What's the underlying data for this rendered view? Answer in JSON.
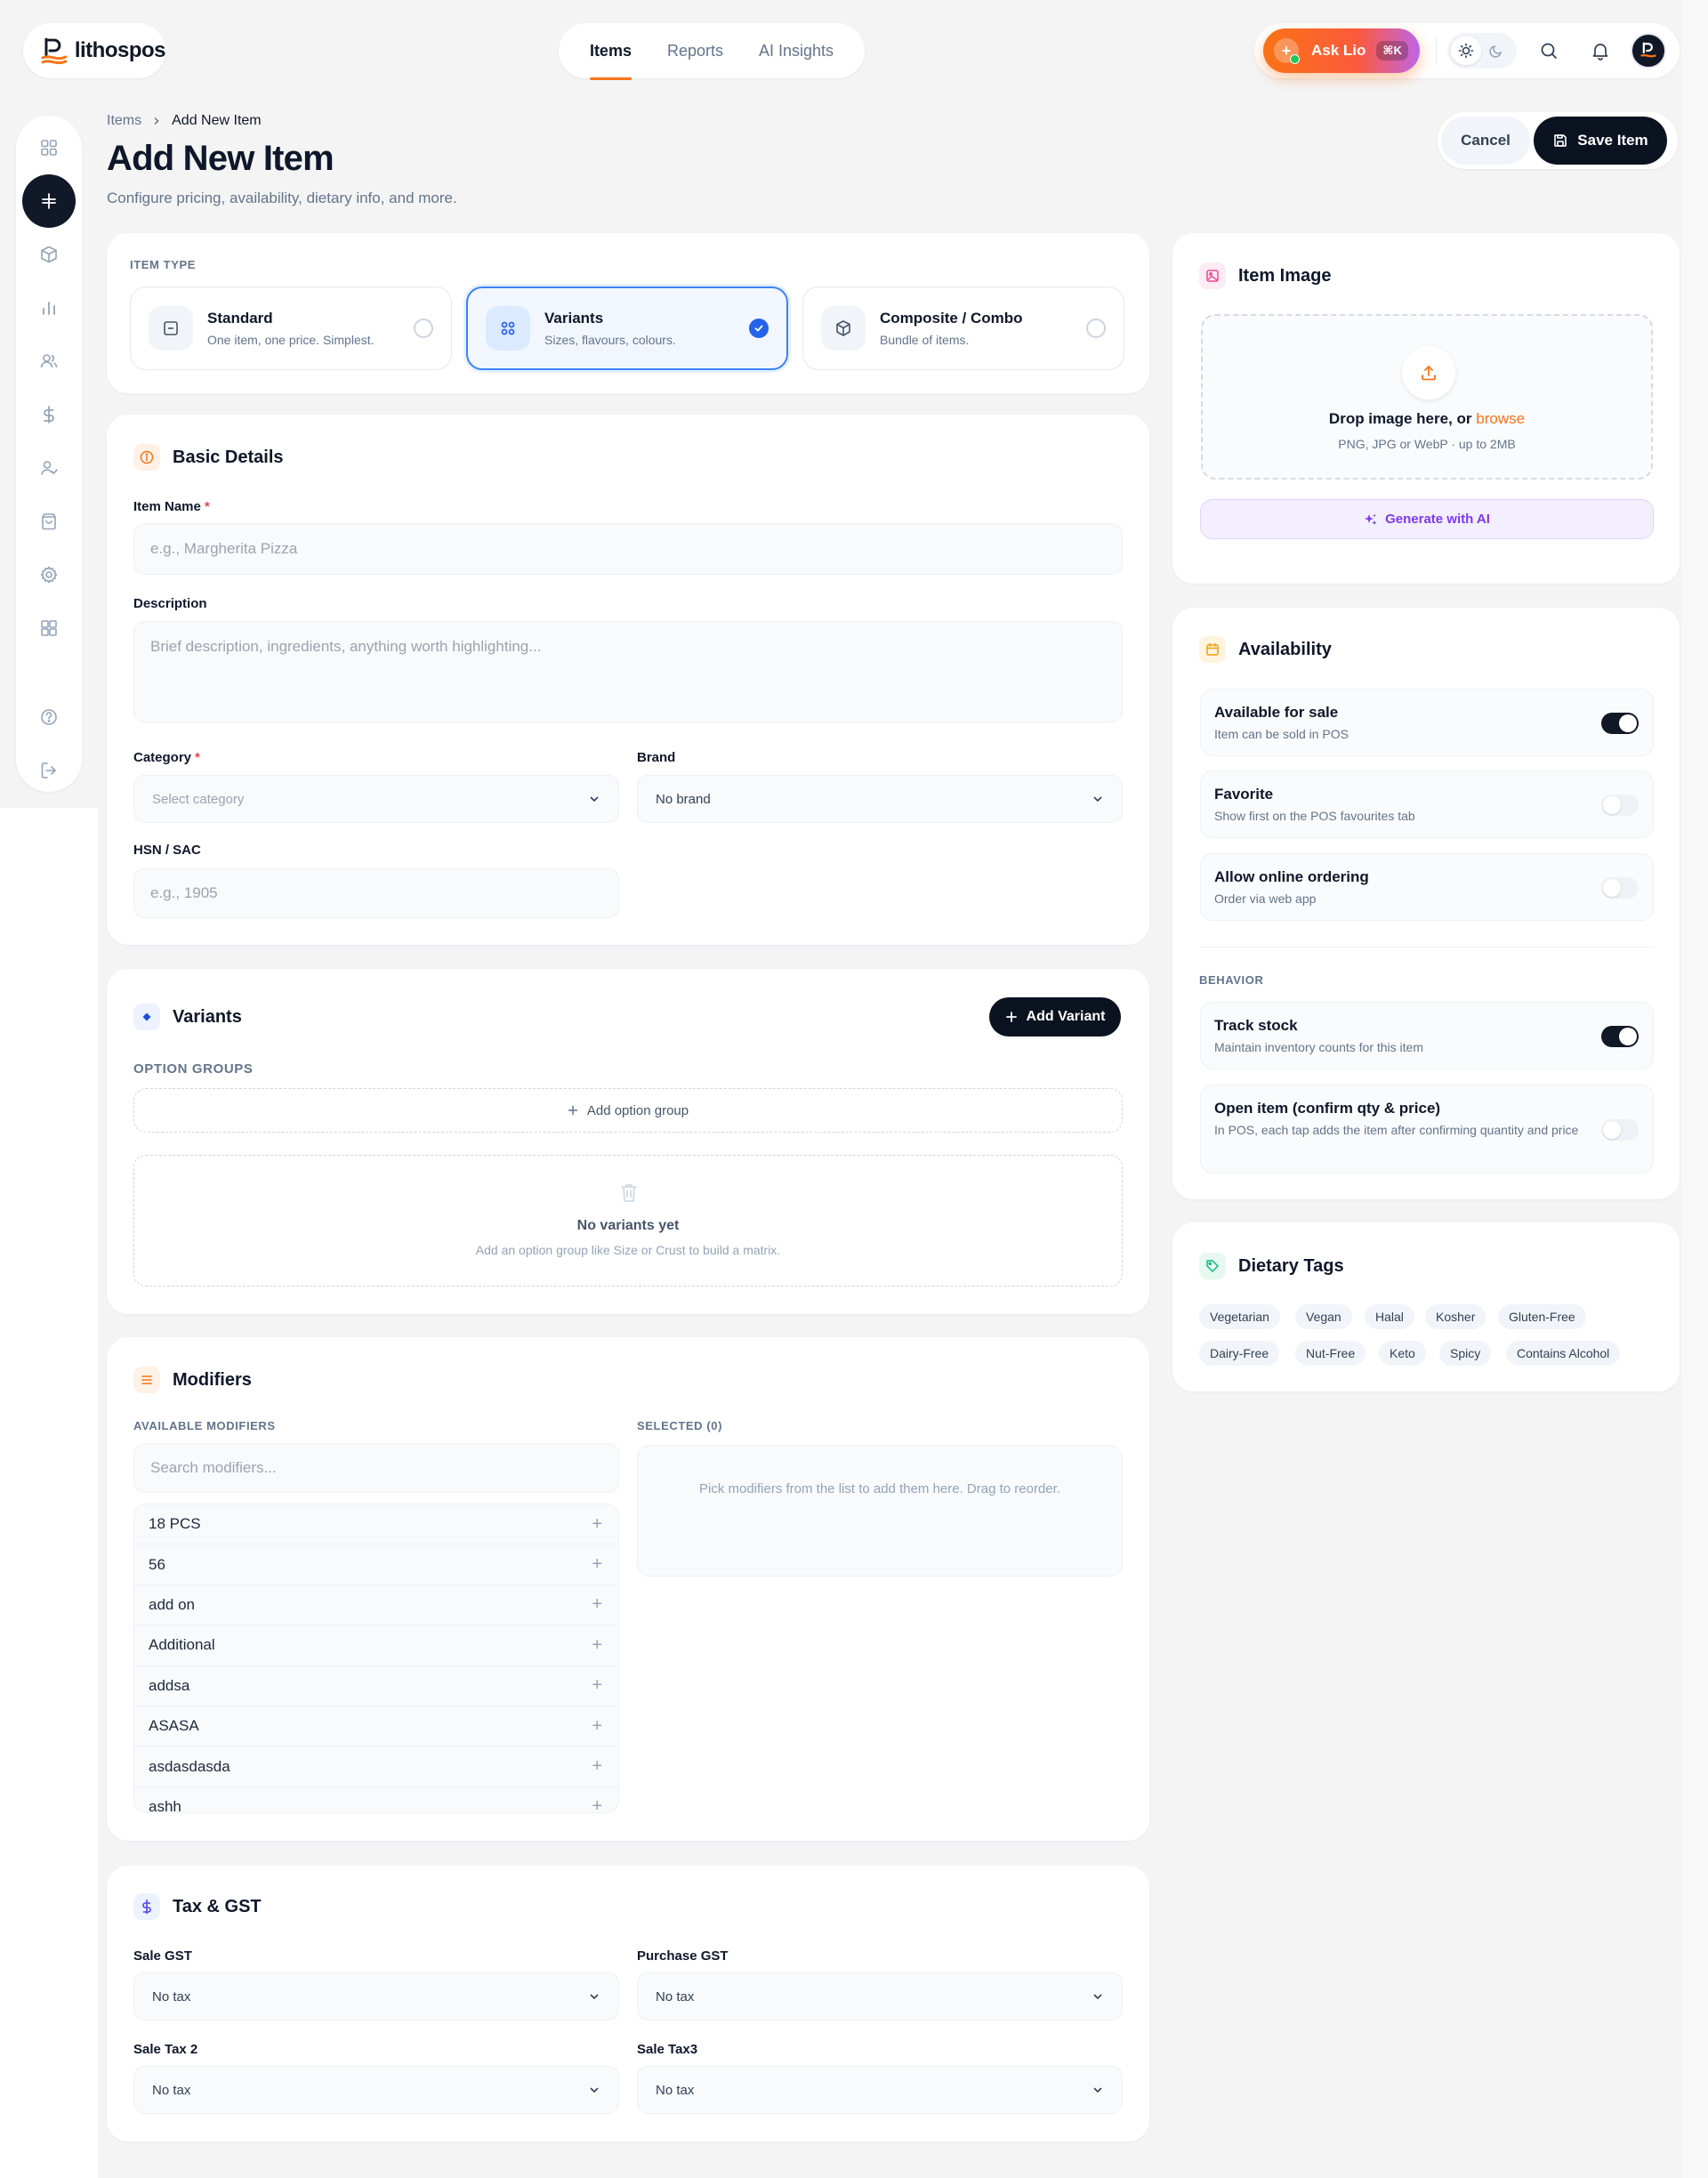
{
  "app": {
    "logo_text": "lithospos"
  },
  "nav": {
    "tabs": [
      {
        "label": "Items"
      },
      {
        "label": "Reports"
      },
      {
        "label": "AI Insights"
      }
    ]
  },
  "header": {
    "ask_label": "Ask Lio",
    "ask_shortcut": "⌘K"
  },
  "breadcrumb": {
    "root": "Items",
    "current": "Add New Item"
  },
  "page": {
    "title": "Add New Item",
    "subtitle": "Configure pricing, availability, dietary info, and more.",
    "cancel_label": "Cancel",
    "save_label": "Save Item"
  },
  "item_type": {
    "label": "ITEM TYPE",
    "options": [
      {
        "name": "Standard",
        "desc": "One item, one price. Simplest."
      },
      {
        "name": "Variants",
        "desc": "Sizes, flavours, colours."
      },
      {
        "name": "Composite / Combo",
        "desc": "Bundle of items."
      }
    ],
    "selected": "Variants"
  },
  "basic": {
    "title": "Basic Details",
    "item_name_label": "Item Name",
    "item_name_placeholder": "e.g., Margherita Pizza",
    "description_label": "Description",
    "description_placeholder": "Brief description, ingredients, anything worth highlighting...",
    "category_label": "Category",
    "category_value": "Select category",
    "brand_label": "Brand",
    "brand_value": "No brand",
    "hsn_label": "HSN / SAC",
    "hsn_placeholder": "e.g., 1905",
    "required_mark": "*"
  },
  "variants": {
    "title": "Variants",
    "add_label": "Add Variant",
    "option_groups_label": "OPTION GROUPS",
    "add_group_label": "Add option group",
    "empty_title": "No variants yet",
    "empty_desc": "Add an option group like Size or Crust to build a matrix."
  },
  "modifiers": {
    "title": "Modifiers",
    "available_label": "AVAILABLE MODIFIERS",
    "selected_label": "SELECTED (0)",
    "search_placeholder": "Search modifiers...",
    "items": [
      "18 PCS",
      "56",
      "add on",
      "Additional",
      "addsa",
      "ASASA",
      "asdasdasda",
      "ashh"
    ],
    "empty_selected": "Pick modifiers from the list to add them here. Drag to reorder."
  },
  "tax": {
    "title": "Tax & GST",
    "sale_gst_label": "Sale GST",
    "sale_gst_value": "No tax",
    "purchase_gst_label": "Purchase GST",
    "purchase_gst_value": "No tax",
    "sale_tax2_label": "Sale Tax 2",
    "sale_tax2_value": "No tax",
    "sale_tax3_label": "Sale Tax3",
    "sale_tax3_value": "No tax"
  },
  "image": {
    "title": "Item Image",
    "drop_text": "Drop image here, or",
    "browse": "browse",
    "formats": "PNG, JPG or WebP · up to 2MB",
    "generate_label": "Generate with AI"
  },
  "availability": {
    "title": "Availability",
    "rows": [
      {
        "title": "Available for sale",
        "desc": "Item can be sold in POS",
        "on": true
      },
      {
        "title": "Favorite",
        "desc": "Show first on the POS favourites tab",
        "on": false
      },
      {
        "title": "Allow online ordering",
        "desc": "Order via web app",
        "on": false
      }
    ],
    "behavior_label": "BEHAVIOR",
    "behavior_rows": [
      {
        "title": "Track stock",
        "desc": "Maintain inventory counts for this item",
        "on": true
      },
      {
        "title": "Open item (confirm qty & price)",
        "desc": "In POS, each tap adds the item after confirming quantity and price",
        "on": false
      }
    ]
  },
  "dietary": {
    "title": "Dietary Tags",
    "tags": [
      "Vegetarian",
      "Vegan",
      "Halal",
      "Kosher",
      "Gluten-Free",
      "Dairy-Free",
      "Nut-Free",
      "Keto",
      "Spicy",
      "Contains Alcohol"
    ]
  },
  "colors": {
    "accent": "#f97316",
    "primary_dark": "#0b1220",
    "selected_blue": "#2563eb",
    "ai_purple": "#7c3aed"
  }
}
